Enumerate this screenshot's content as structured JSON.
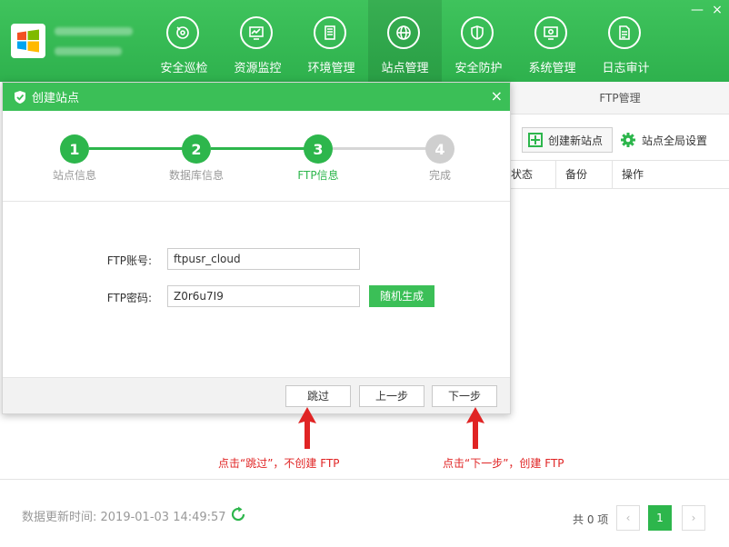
{
  "nav": {
    "items": [
      {
        "label": "安全巡检",
        "icon": "scan-icon"
      },
      {
        "label": "资源监控",
        "icon": "monitor-icon"
      },
      {
        "label": "环境管理",
        "icon": "server-icon"
      },
      {
        "label": "站点管理",
        "icon": "globe-icon"
      },
      {
        "label": "安全防护",
        "icon": "shield-icon"
      },
      {
        "label": "系统管理",
        "icon": "settings-screen-icon"
      },
      {
        "label": "日志审计",
        "icon": "document-icon"
      }
    ],
    "active_index": 3
  },
  "window": {
    "minimize": "—",
    "close": "×"
  },
  "right_panel": {
    "tab_title": "FTP管理",
    "create_site_label": "创建新站点",
    "global_settings_label": "站点全局设置",
    "columns": [
      "状态",
      "备份",
      "操作"
    ]
  },
  "dialog": {
    "title": "创建站点",
    "close": "×",
    "steps": [
      {
        "num": "1",
        "label": "站点信息",
        "state": "done"
      },
      {
        "num": "2",
        "label": "数据库信息",
        "state": "done"
      },
      {
        "num": "3",
        "label": "FTP信息",
        "state": "active"
      },
      {
        "num": "4",
        "label": "完成",
        "state": "pending"
      }
    ],
    "ftp_account_label": "FTP账号:",
    "ftp_account_value": "ftpusr_cloud",
    "ftp_password_label": "FTP密码:",
    "ftp_password_value": "Z0r6u7I9",
    "generate_label": "随机生成",
    "skip_label": "跳过",
    "prev_label": "上一步",
    "next_label": "下一步"
  },
  "annotations": {
    "skip_note": "点击“跳过”，不创建 FTP",
    "next_note": "点击“下一步”，创建 FTP"
  },
  "footer": {
    "update_time": "数据更新时间: 2019-01-03 14:49:57",
    "total": "共 0 项",
    "current_page": "1"
  },
  "colors": {
    "brand_green": "#2db64c",
    "annotation_red": "#e02424"
  }
}
